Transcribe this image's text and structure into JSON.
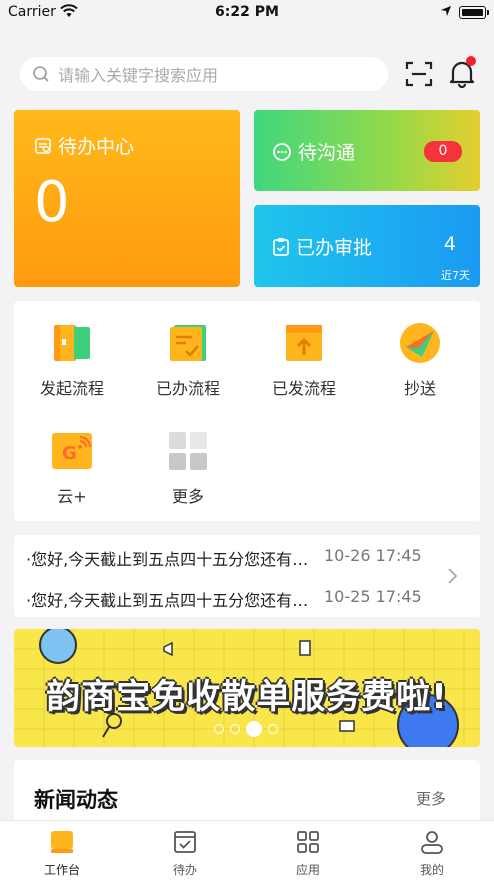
{
  "status": {
    "carrier": "Carrier",
    "time": "6:22 PM"
  },
  "search": {
    "placeholder": "请输入关键字搜索应用"
  },
  "cards": {
    "todo": {
      "title": "待办中心",
      "count": "0"
    },
    "comm": {
      "title": "待沟通",
      "badge": "0"
    },
    "approved": {
      "title": "已办审批",
      "count": "4",
      "sub": "近7天"
    }
  },
  "apps": [
    {
      "label": "发起流程",
      "icon": "start-process-icon"
    },
    {
      "label": "已办流程",
      "icon": "done-process-icon"
    },
    {
      "label": "已发流程",
      "icon": "sent-process-icon"
    },
    {
      "label": "抄送",
      "icon": "cc-icon"
    },
    {
      "label": "云+",
      "icon": "cloud-plus-icon"
    },
    {
      "label": "更多",
      "icon": "more-grid-icon"
    }
  ],
  "notices": [
    {
      "text": "·您好,今天截止到五点四十五分您还有未处理的待办",
      "time": "10-26 17:45"
    },
    {
      "text": "·您好,今天截止到五点四十五分您还有未处理的待办",
      "time": "10-25 17:45"
    }
  ],
  "banner": {
    "text": "韵商宝免收散单服务费啦!"
  },
  "news": {
    "title": "新闻动态",
    "more": "更多"
  },
  "tabs": [
    {
      "label": "工作台",
      "icon": "workbench-icon"
    },
    {
      "label": "待办",
      "icon": "todo-icon"
    },
    {
      "label": "应用",
      "icon": "apps-icon"
    },
    {
      "label": "我的",
      "icon": "profile-icon"
    }
  ],
  "colors": {
    "accent": "#ff9f10",
    "green": "#3fd77f",
    "blue": "#1b9af3",
    "badge": "#f4333c"
  }
}
